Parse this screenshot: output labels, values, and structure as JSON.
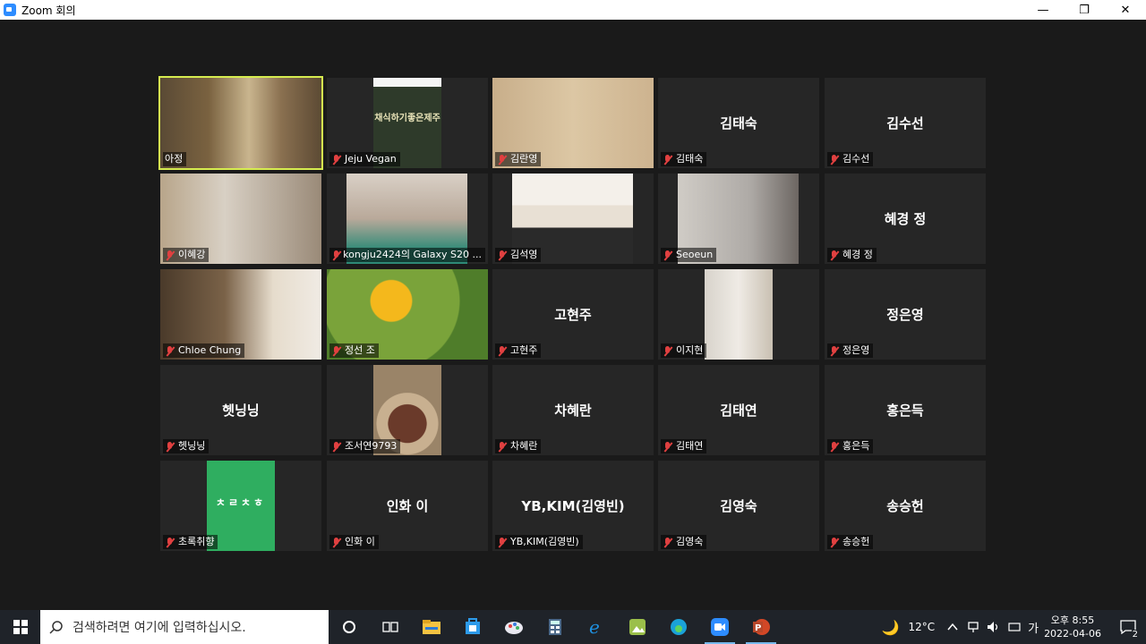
{
  "window": {
    "title": "Zoom 회의",
    "minimize": "—",
    "restore": "❐",
    "close": "✕"
  },
  "participants": [
    {
      "name": "아정",
      "center": "",
      "muted": false,
      "active": true,
      "video": true
    },
    {
      "name": "Jeju Vegan",
      "center": "",
      "muted": true,
      "active": false,
      "video": true,
      "overlay": "채식하기좋은제주"
    },
    {
      "name": "김란영",
      "center": "",
      "muted": true,
      "active": false,
      "video": true
    },
    {
      "name": "김태숙",
      "center": "김태숙",
      "muted": true,
      "active": false,
      "video": false
    },
    {
      "name": "김수선",
      "center": "김수선",
      "muted": true,
      "active": false,
      "video": false
    },
    {
      "name": "이혜강",
      "center": "",
      "muted": true,
      "active": false,
      "video": true
    },
    {
      "name": "kongju2424의 Galaxy S20 ...",
      "center": "",
      "muted": true,
      "active": false,
      "video": true
    },
    {
      "name": "김석영",
      "center": "",
      "muted": true,
      "active": false,
      "video": true
    },
    {
      "name": "Seoeun",
      "center": "",
      "muted": true,
      "active": false,
      "video": true
    },
    {
      "name": "혜경 정",
      "center": "혜경 정",
      "muted": true,
      "active": false,
      "video": false
    },
    {
      "name": "Chloe Chung",
      "center": "",
      "muted": true,
      "active": false,
      "video": true
    },
    {
      "name": "정선 조",
      "center": "",
      "muted": true,
      "active": false,
      "video": true
    },
    {
      "name": "고현주",
      "center": "고현주",
      "muted": true,
      "active": false,
      "video": false
    },
    {
      "name": "이지현",
      "center": "",
      "muted": true,
      "active": false,
      "video": true
    },
    {
      "name": "정은영",
      "center": "정은영",
      "muted": true,
      "active": false,
      "video": false
    },
    {
      "name": "헷닝닝",
      "center": "헷닝닝",
      "muted": true,
      "active": false,
      "video": false
    },
    {
      "name": "조서연9793",
      "center": "",
      "muted": true,
      "active": false,
      "video": true
    },
    {
      "name": "차혜란",
      "center": "차혜란",
      "muted": true,
      "active": false,
      "video": false
    },
    {
      "name": "김태연",
      "center": "김태연",
      "muted": true,
      "active": false,
      "video": false
    },
    {
      "name": "홍은득",
      "center": "홍은득",
      "muted": true,
      "active": false,
      "video": false
    },
    {
      "name": "초록취향",
      "center": "",
      "muted": true,
      "active": false,
      "video": true,
      "overlay": "ㅊㄹㅊㅎ"
    },
    {
      "name": "인화 이",
      "center": "인화 이",
      "muted": true,
      "active": false,
      "video": false
    },
    {
      "name": "YB,KIM(김영빈)",
      "center": "YB,KIM(김영빈)",
      "muted": true,
      "active": false,
      "video": false
    },
    {
      "name": "김영숙",
      "center": "김영숙",
      "muted": true,
      "active": false,
      "video": false
    },
    {
      "name": "송승헌",
      "center": "송승헌",
      "muted": true,
      "active": false,
      "video": false
    }
  ],
  "taskbar": {
    "search_placeholder": "검색하려면 여기에 입력하십시오.",
    "apps": [
      "task-view-icon",
      "file-explorer-icon",
      "store-icon",
      "paint-icon",
      "calculator-icon",
      "ie-icon",
      "photos-icon",
      "edge-icon",
      "zoom-icon",
      "powerpoint-icon"
    ],
    "weather": "12°C",
    "ime": "가",
    "time": "오후 8:55",
    "date": "2022-04-06",
    "notifications": "2"
  },
  "colors": {
    "active_border": "#d6ec4f",
    "tile_bg": "#262626",
    "mute": "#e04040",
    "accent": "#2d8cff"
  }
}
